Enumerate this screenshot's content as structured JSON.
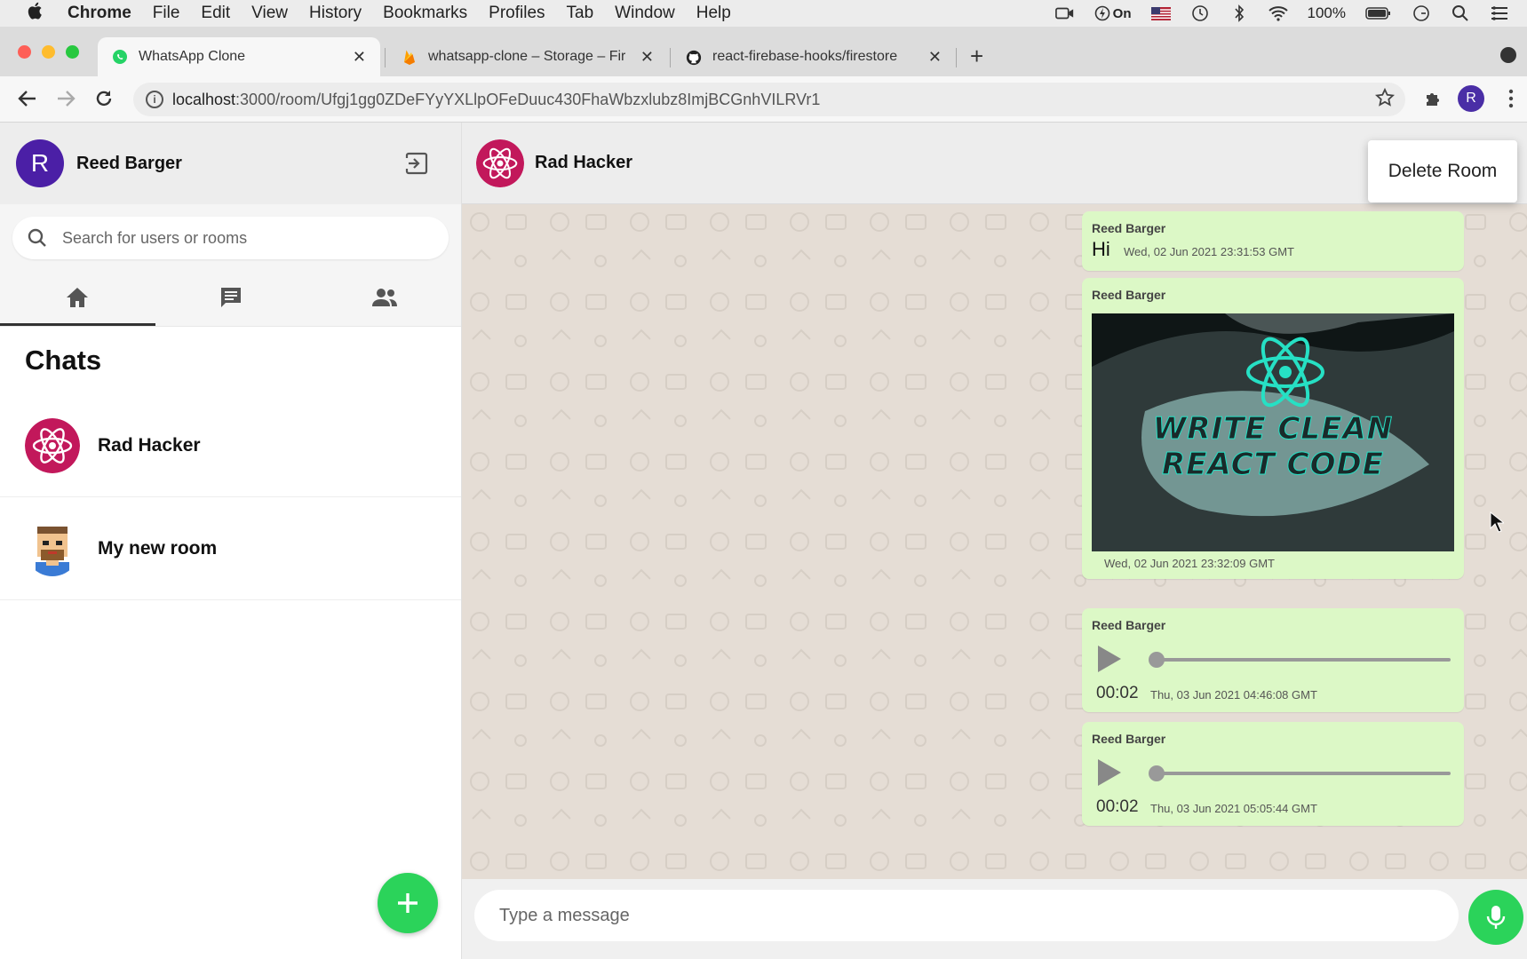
{
  "menubar": {
    "app": "Chrome",
    "items": [
      "File",
      "Edit",
      "View",
      "History",
      "Bookmarks",
      "Profiles",
      "Tab",
      "Window",
      "Help"
    ],
    "status": {
      "focus_label": "On",
      "battery": "100%"
    }
  },
  "browser": {
    "tabs": [
      {
        "title": "WhatsApp Clone",
        "icon": "whatsapp-icon"
      },
      {
        "title": "whatsapp-clone – Storage – Fir",
        "icon": "firebase-icon"
      },
      {
        "title": "react-firebase-hooks/firestore",
        "icon": "github-icon"
      }
    ],
    "url_host": "localhost",
    "url_path": ":3000/room/Ufgj1gg0ZDeFYyYXLlpOFeDuuc430FhaWbzxlubz8ImjBCGnhVILRVr1",
    "profile_initial": "R"
  },
  "sidebar": {
    "user_initial": "R",
    "user_name": "Reed Barger",
    "search_placeholder": "Search for users or rooms",
    "section_title": "Chats",
    "chats": [
      {
        "name": "Rad Hacker",
        "avatar": "atom-avatar"
      },
      {
        "name": "My new room",
        "avatar": "pixel-avatar"
      }
    ]
  },
  "chat": {
    "room_name": "Rad Hacker",
    "menu_item": "Delete Room",
    "messages": [
      {
        "type": "text",
        "sender": "Reed Barger",
        "text": "Hi",
        "time": "Wed, 02 Jun 2021 23:31:53 GMT"
      },
      {
        "type": "image",
        "sender": "Reed Barger",
        "image_caption_line1": "WRITE CLEAN",
        "image_caption_line2": "REACT CODE",
        "time": "Wed, 02 Jun 2021 23:32:09 GMT"
      },
      {
        "type": "audio",
        "sender": "Reed Barger",
        "duration": "00:02",
        "time": "Thu, 03 Jun 2021 04:46:08 GMT"
      },
      {
        "type": "audio",
        "sender": "Reed Barger",
        "duration": "00:02",
        "time": "Thu, 03 Jun 2021 05:05:44 GMT"
      }
    ],
    "composer_placeholder": "Type a message"
  },
  "colors": {
    "accent_green": "#2bd35a",
    "bubble_green": "#dcf8c6",
    "avatar_purple": "#4b1fa6",
    "atom_magenta": "#c2185b"
  }
}
